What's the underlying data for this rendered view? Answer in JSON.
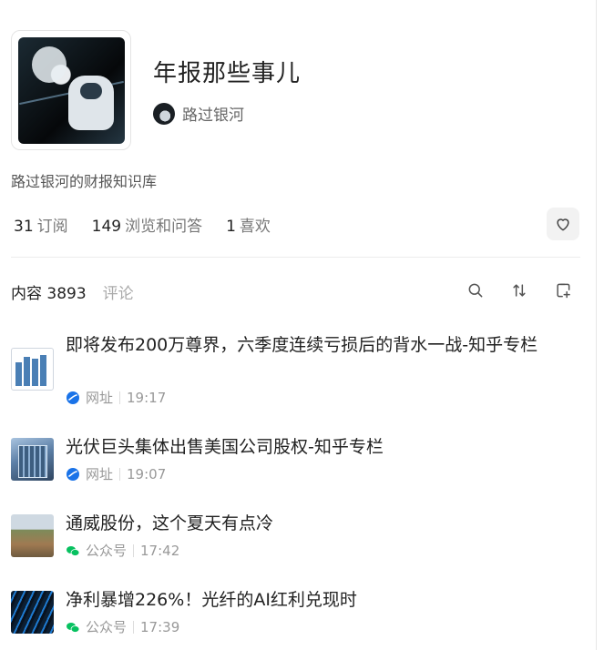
{
  "header": {
    "title": "年报那些事儿",
    "author": "路过银河",
    "description": "路过银河的财报知识库"
  },
  "stats": [
    {
      "value": "31",
      "label": "订阅"
    },
    {
      "value": "149",
      "label": "浏览和问答"
    },
    {
      "value": "1",
      "label": "喜欢"
    }
  ],
  "tabs": {
    "content_label": "内容 3893",
    "comments_label": "评论"
  },
  "items": [
    {
      "title": "即将发布200万尊界，六季度连续亏损后的背水一战-知乎专栏",
      "source": "网址",
      "time": "19:17",
      "source_icon": "globe-icon",
      "thumb": "bar-chart"
    },
    {
      "title": "光伏巨头集体出售美国公司股权-知乎专栏",
      "source": "网址",
      "time": "19:07",
      "source_icon": "globe-icon",
      "thumb": "building"
    },
    {
      "title": "通威股份，这个夏天有点冷",
      "source": "公众号",
      "time": "17:42",
      "source_icon": "wechat-icon",
      "thumb": "landscape"
    },
    {
      "title": "净利暴增226%！光纤的AI红利兑现时",
      "source": "公众号",
      "time": "17:39",
      "source_icon": "wechat-icon",
      "thumb": "fiber"
    }
  ],
  "colors": {
    "globe": "#1a73e8",
    "wechat": "#07c160"
  }
}
